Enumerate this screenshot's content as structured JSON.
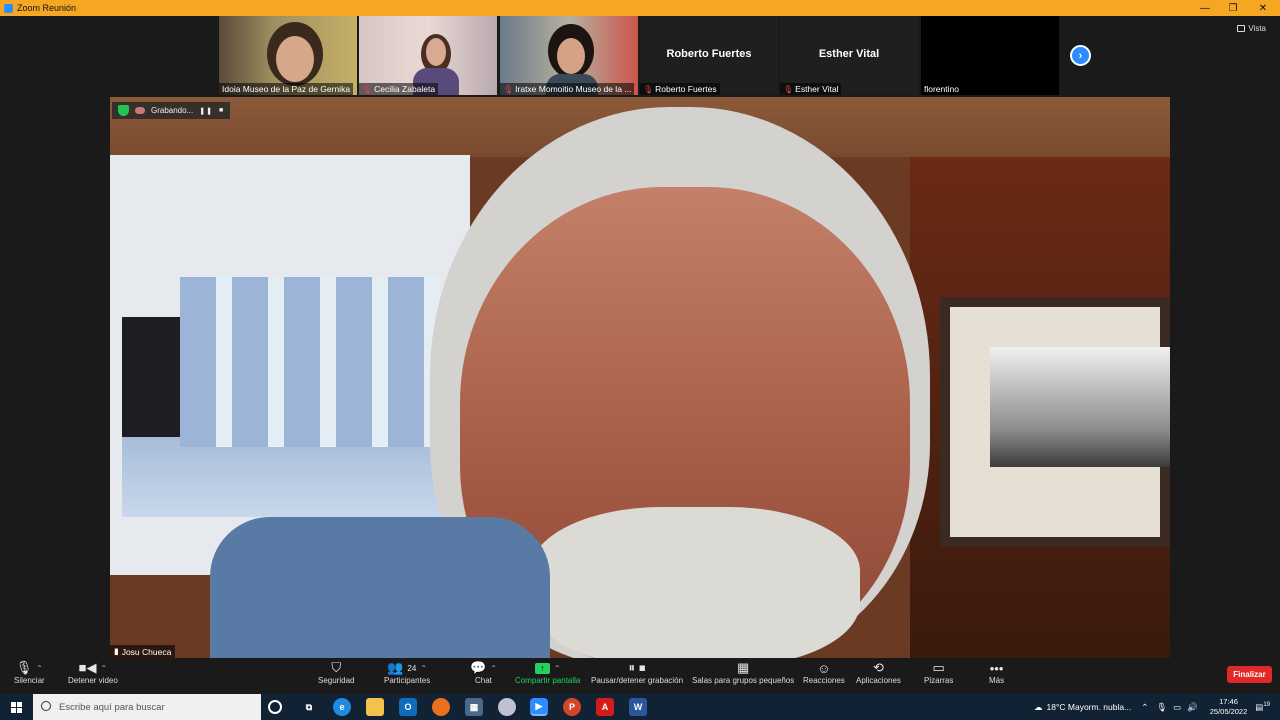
{
  "window": {
    "title": "Zoom Reunión",
    "minimize": "—",
    "restore": "❐",
    "close": "✕"
  },
  "view_button": {
    "label": "Vista"
  },
  "participants_strip": [
    {
      "name": "Idoia Museo de la Paz de Gernika",
      "has_video": true,
      "muted": false
    },
    {
      "name": "Cecilia Zabaleta",
      "has_video": true,
      "muted": true
    },
    {
      "name": "Iratxe Momoitio Museo de la ...",
      "has_video": true,
      "muted": true
    },
    {
      "name": "Roberto Fuertes",
      "big_name": "Roberto Fuertes",
      "has_video": false,
      "muted": true
    },
    {
      "name": "Esther Vital",
      "big_name": "Esther Vital",
      "has_video": false,
      "muted": true
    },
    {
      "name": "florentino",
      "has_video": false,
      "muted": false
    }
  ],
  "recording": {
    "label": "Grabando...",
    "pause": "❚❚",
    "stop": "■"
  },
  "active_speaker": {
    "name": "Josu Chueca"
  },
  "toolbar": {
    "mute": "Silenciar",
    "video": "Detener video",
    "security": "Seguridad",
    "participants": "Participantes",
    "participants_count": "24",
    "chat": "Chat",
    "share": "Compartir pantalla",
    "record": "Pausar/detener grabación",
    "breakout": "Salas para grupos pequeños",
    "reactions": "Reacciones",
    "apps": "Aplicaciones",
    "whiteboards": "Pizarras",
    "more": "Más",
    "end": "Finalizar"
  },
  "taskbar": {
    "search_placeholder": "Escribe aquí para buscar",
    "weather": "18°C  Mayorm. nubla...",
    "time": "17:46",
    "date": "25/05/2022",
    "notifications": "19"
  },
  "colors": {
    "zoom_blue": "#2d8cff",
    "title_bar": "#f5a623",
    "share_green": "#23d160",
    "end_red": "#e02828"
  }
}
